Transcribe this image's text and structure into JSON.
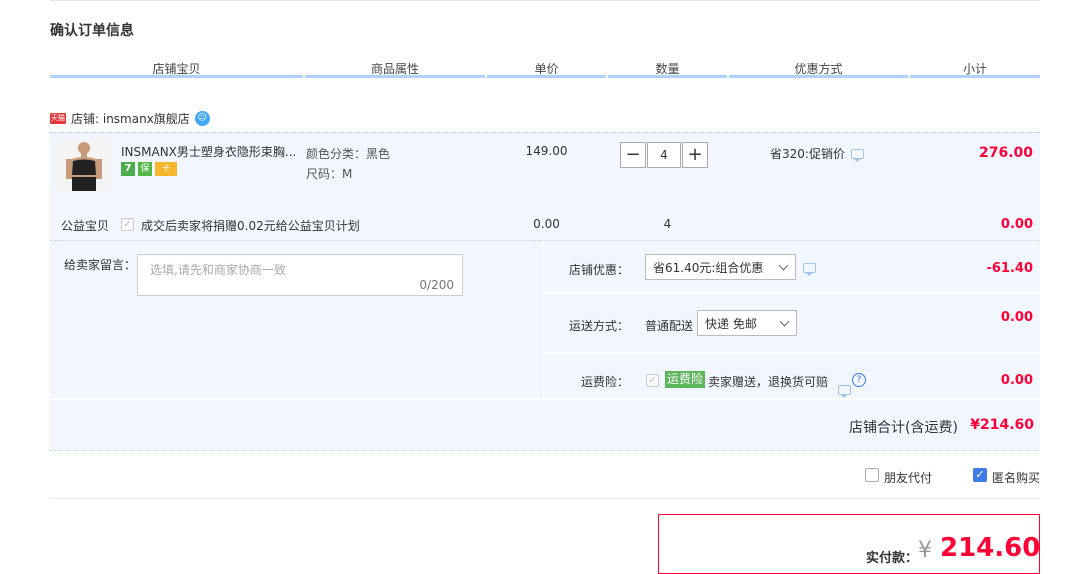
{
  "page": {
    "title": "确认订单信息"
  },
  "columns": [
    "店铺宝贝",
    "商品属性",
    "单价",
    "数量",
    "优惠方式",
    "小计"
  ],
  "shop": {
    "badge": "天猫",
    "label": "店铺: insmanx旗舰店"
  },
  "item": {
    "name": "INSMANX男士塑身衣隐形束胸...",
    "badges": [
      "7",
      "保",
      "卡"
    ],
    "attr_color": "颜色分类：黑色",
    "attr_size": "尺码：M",
    "price": "149.00",
    "quantity": "4",
    "discount": "省320:促销价",
    "subtotal": "276.00"
  },
  "charity": {
    "label": "公益宝贝",
    "desc": "成交后卖家将捐赠0.02元给公益宝贝计划",
    "price": "0.00",
    "quantity": "4",
    "subtotal": "0.00"
  },
  "message": {
    "label": "给卖家留言：",
    "placeholder": "选填,请先和商家协商一致",
    "counter": "0/200"
  },
  "shop_discount": {
    "label": "店铺优惠：",
    "selected": "省61.40元:组合优惠",
    "amount": "-61.40"
  },
  "shipping": {
    "label": "运送方式：",
    "type": "普通配送",
    "selected": "快递 免邮",
    "amount": "0.00"
  },
  "insurance": {
    "label": "运费险：",
    "tag": "运费险",
    "desc": "卖家赠送，退换货可赔",
    "amount": "0.00"
  },
  "shop_total": {
    "label": "店铺合计(含运费)",
    "amount": "¥214.60"
  },
  "options": {
    "friend_pay": "朋友代付",
    "anonymous": "匿名购买"
  },
  "payment": {
    "label": "实付款：",
    "currency": "¥",
    "amount": "214.60"
  }
}
